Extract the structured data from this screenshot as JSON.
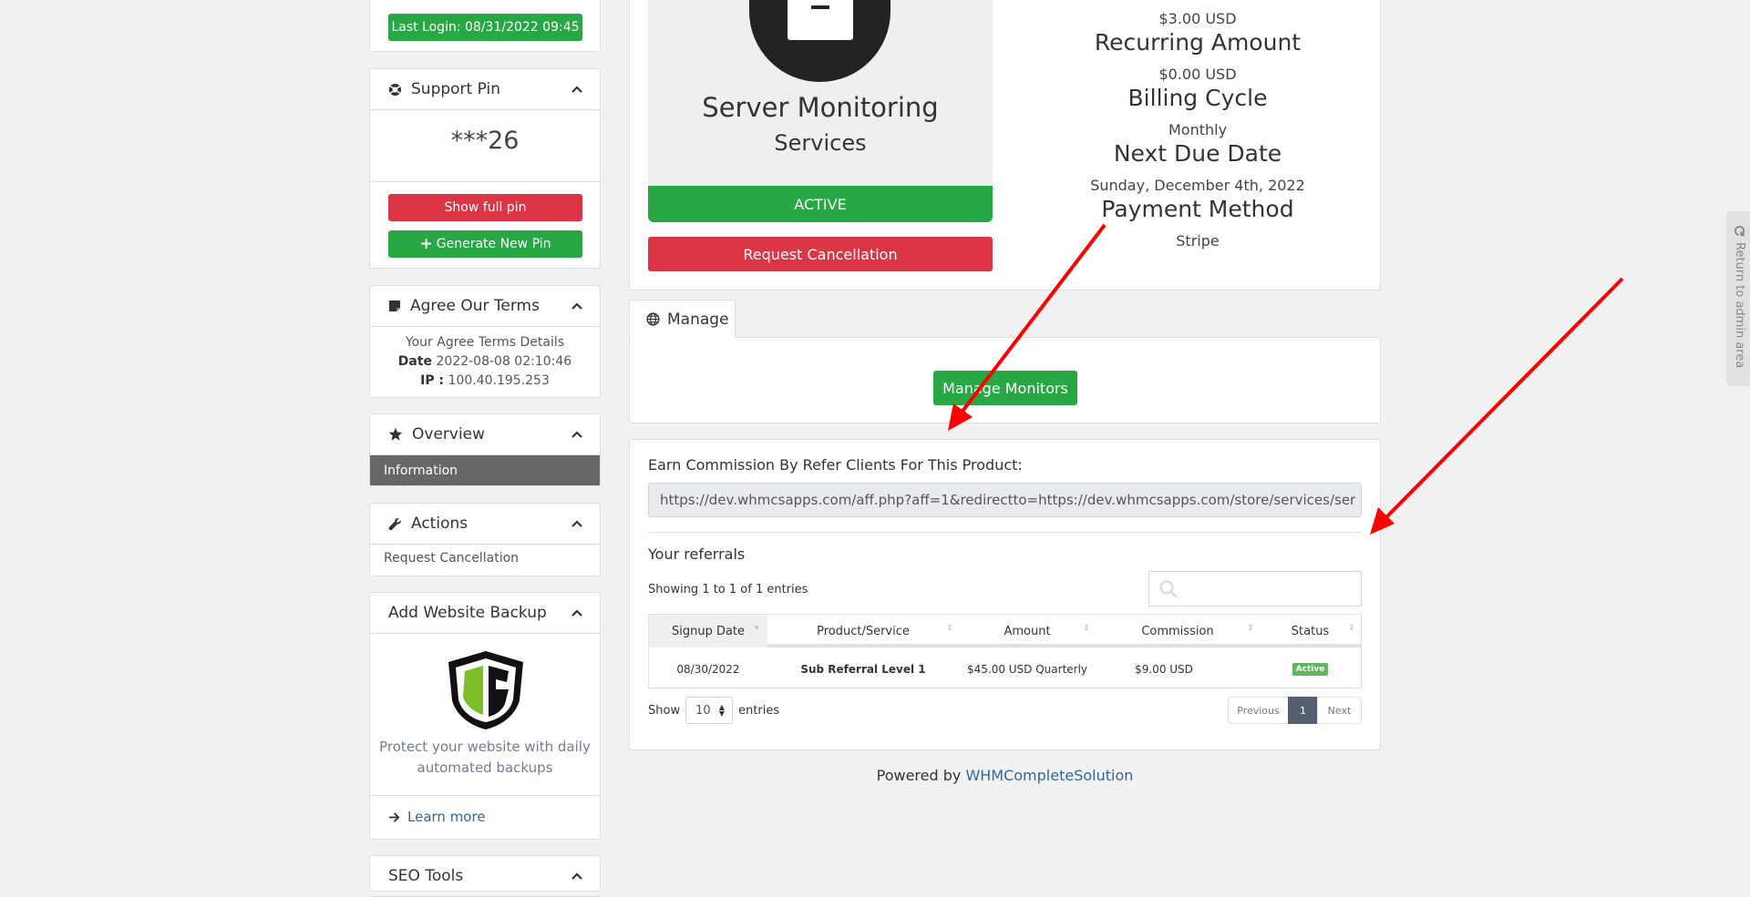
{
  "sidebar": {
    "last_login": "Last Login: 08/31/2022 09:45",
    "support_pin": {
      "title": "Support Pin",
      "masked": "***26",
      "show_button": "Show full pin",
      "generate_button": "Generate New Pin"
    },
    "agree_terms": {
      "title": "Agree Our Terms",
      "details_line": "Your Agree Terms Details",
      "date_label": "Date",
      "date_value": "2022-08-08 02:10:46",
      "ip_label": "IP :",
      "ip_value": "100.40.195.253"
    },
    "overview": {
      "title": "Overview",
      "item": "Information"
    },
    "actions": {
      "title": "Actions",
      "item": "Request Cancellation"
    },
    "backup": {
      "title": "Add Website Backup",
      "text_line1": "Protect your website with daily",
      "text_line2": "automated backups",
      "learn_more": "Learn more"
    },
    "seo": {
      "title": "SEO Tools"
    }
  },
  "product": {
    "name": "Server Monitoring",
    "group": "Services",
    "status": "ACTIVE",
    "cancel_button": "Request Cancellation",
    "first_amount_value": "$3.00 USD",
    "recurring_label": "Recurring Amount",
    "recurring_value": "$0.00 USD",
    "billing_label": "Billing Cycle",
    "billing_value": "Monthly",
    "due_label": "Next Due Date",
    "due_value": "Sunday, December 4th, 2022",
    "payment_label": "Payment Method",
    "payment_value": "Stripe"
  },
  "manage": {
    "tab_label": "Manage",
    "button": "Manage Monitors"
  },
  "affiliate": {
    "label": "Earn Commission By Refer Clients For This Product:",
    "link": "https://dev.whmcsapps.com/aff.php?aff=1&redirectto=https://dev.whmcsapps.com/store/services/ser",
    "referrals_title": "Your referrals",
    "showing": "Showing 1 to 1 of 1 entries",
    "columns": [
      "Signup Date",
      "Product/Service",
      "Amount",
      "Commission",
      "Status"
    ],
    "rows": [
      {
        "date": "08/30/2022",
        "product": "Sub Referral Level 1",
        "amount": "$45.00 USD Quarterly",
        "commission": "$9.00 USD",
        "status": "Active"
      }
    ],
    "show_label": "Show",
    "page_size": "10",
    "entries_label": "entries",
    "pager": {
      "previous": "Previous",
      "current": "1",
      "next": "Next"
    }
  },
  "footer": {
    "powered_by": "Powered by",
    "link": "WHMCompleteSolution"
  },
  "admin_tab": "Return to admin area",
  "colors": {
    "green": "#28a745",
    "red": "#dc3545",
    "dark": "#222222",
    "link": "#336699",
    "arrow": "#ff0000"
  }
}
